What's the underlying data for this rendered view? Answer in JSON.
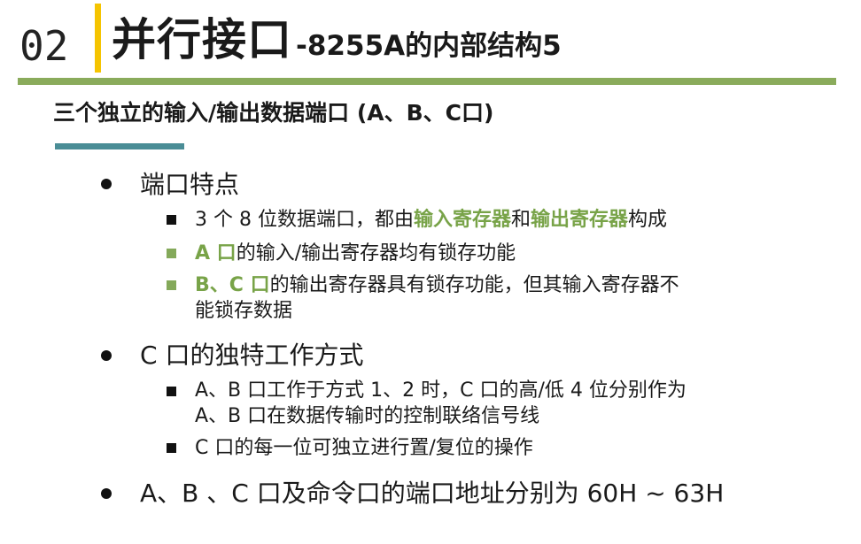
{
  "header": {
    "section_number": "02",
    "title_main": "并行接口",
    "title_sub": "-8255A的内部结构5",
    "accent_yellow": "#f5c400",
    "accent_green": "#8aab5b",
    "accent_teal": "#4a8d96"
  },
  "subtitle": "三个独立的输入/输出数据端口 (A、B、C口)",
  "sections": [
    {
      "heading": "端口特点",
      "items": [
        {
          "pre": "3 个 8 位数据端口，都由",
          "hl1": "输入寄存器",
          "mid": "和",
          "hl2": "输出寄存器",
          "post": "构成"
        },
        {
          "hl": "A 口",
          "text": "的输入/输出寄存器均有锁存功能"
        },
        {
          "hl": "B、C 口",
          "text": "的输出寄存器具有锁存功能，但其输入寄存器不",
          "text2": "能锁存数据"
        }
      ]
    },
    {
      "heading": "C 口的独特工作方式",
      "items": [
        {
          "line1": "A、B 口工作于方式 1、2 时，C 口的高/低 4 位分别作为",
          "line2": "A、B 口在数据传输时的控制联络信号线"
        },
        {
          "text": "C 口的每一位可独立进行置/复位的操作"
        }
      ]
    },
    {
      "heading": "A、B 、C 口及命令口的端口地址分别为 60H ~ 63H"
    }
  ]
}
